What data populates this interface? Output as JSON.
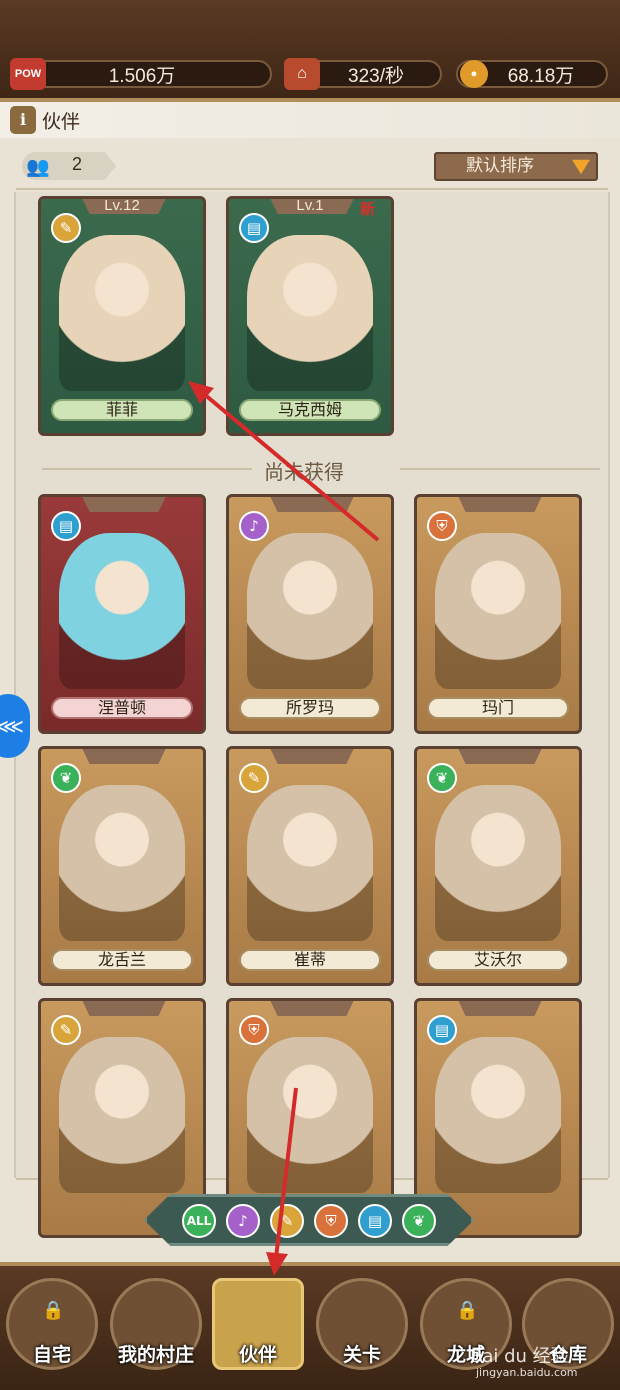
{
  "topbar": {
    "pow": {
      "icon_label": "POW",
      "value": "1.506万"
    },
    "rate": {
      "icon": "house-coin-icon",
      "value": "323/秒"
    },
    "coins": {
      "icon": "coin-icon",
      "value": "68.18万"
    }
  },
  "header": {
    "icon": "info-icon",
    "icon_glyph": "i",
    "title": "伙伴"
  },
  "owned_count": {
    "icon": "people-icon",
    "value": "2"
  },
  "sort": {
    "label": "默认排序",
    "icon": "caret-down-icon"
  },
  "owned": [
    {
      "level": "Lv.12",
      "name": "菲菲",
      "new": "",
      "class_icon": "broom-icon",
      "color": "green"
    },
    {
      "level": "Lv.1",
      "name": "马克西姆",
      "new": "新",
      "class_icon": "book-icon",
      "color": "green"
    }
  ],
  "unobtained_label": "尚未获得",
  "unobtained": [
    {
      "name": "涅普顿",
      "class_icon": "book-icon",
      "color": "red"
    },
    {
      "name": "所罗玛",
      "class_icon": "lyre-icon",
      "color": "gold"
    },
    {
      "name": "玛门",
      "class_icon": "shield-icon",
      "color": "gold"
    },
    {
      "name": "龙舌兰",
      "class_icon": "leaf-icon",
      "color": "gold"
    },
    {
      "name": "崔蒂",
      "class_icon": "broom-icon",
      "color": "gold"
    },
    {
      "name": "艾沃尔",
      "class_icon": "leaf-icon",
      "color": "gold"
    },
    {
      "name": "",
      "class_icon": "broom-icon",
      "color": "gold"
    },
    {
      "name": "",
      "class_icon": "shield-icon",
      "color": "gold"
    },
    {
      "name": "",
      "class_icon": "book-icon",
      "color": "gold"
    }
  ],
  "filters": [
    {
      "label": "ALL",
      "icon": "all-icon",
      "color": "#3bb15a"
    },
    {
      "label": "",
      "icon": "lyre-icon",
      "color": "#a560c9"
    },
    {
      "label": "",
      "icon": "broom-icon",
      "color": "#d9a43a"
    },
    {
      "label": "",
      "icon": "shield-icon",
      "color": "#d9713a"
    },
    {
      "label": "",
      "icon": "book-icon",
      "color": "#2f9fd0"
    },
    {
      "label": "",
      "icon": "leaf-icon",
      "color": "#3bb15a"
    }
  ],
  "nav": [
    {
      "label": "自宅",
      "locked": true
    },
    {
      "label": "我的村庄",
      "locked": false
    },
    {
      "label": "伙伴",
      "locked": false,
      "active": true
    },
    {
      "label": "关卡",
      "locked": false
    },
    {
      "label": "龙城",
      "locked": true
    },
    {
      "label": "仓库",
      "locked": false
    }
  ],
  "watermark": {
    "line1": "Bai du 经验",
    "line2": "jingyan.baidu.com"
  },
  "colors": {
    "accent_arrow": "#d42a2a",
    "panel": "#e4ded1",
    "bar": "#4a2f1c"
  }
}
